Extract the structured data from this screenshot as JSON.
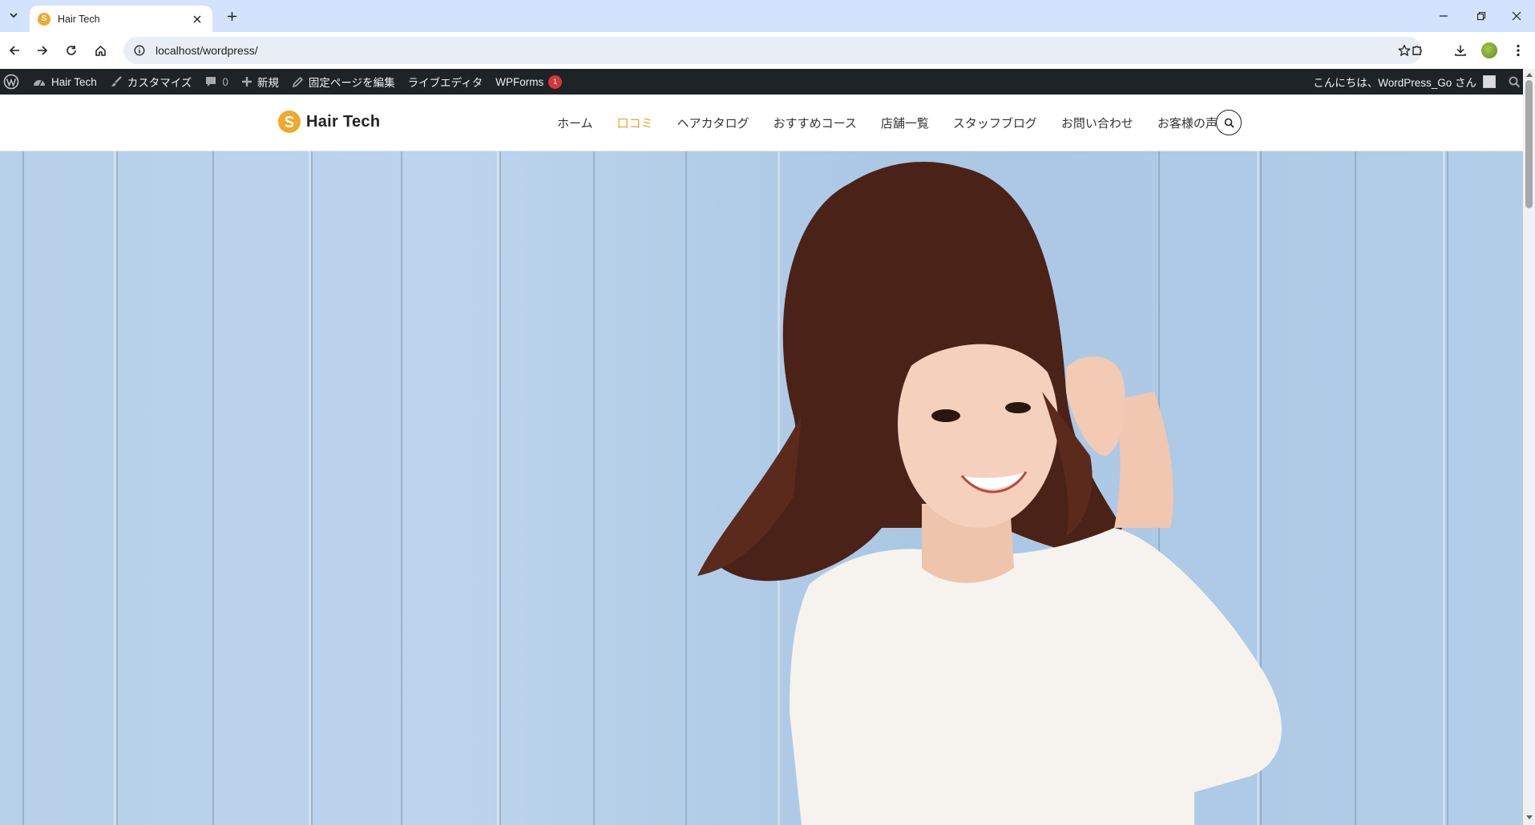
{
  "browser": {
    "tab_title": "Hair Tech",
    "url": "localhost/wordpress/"
  },
  "adminbar": {
    "site_name": "Hair Tech",
    "customize": "カスタマイズ",
    "comments_count": "0",
    "new": "新規",
    "edit_page": "固定ページを編集",
    "live_editor": "ライブエディタ",
    "wpforms": "WPForms",
    "wpforms_badge": "1",
    "greeting": "こんにちは、WordPress_Go さん"
  },
  "site": {
    "logo_text": "Hair Tech",
    "accent_color": "#e8a32b",
    "nav": [
      {
        "label": "ホーム",
        "active": false
      },
      {
        "label": "口コミ",
        "active": true
      },
      {
        "label": "ヘアカタログ",
        "active": false
      },
      {
        "label": "おすすめコース",
        "active": false
      },
      {
        "label": "店舗一覧",
        "active": false
      },
      {
        "label": "スタッフブログ",
        "active": false
      },
      {
        "label": "お問い合わせ",
        "active": false
      },
      {
        "label": "お客様の声",
        "active": false
      }
    ]
  }
}
